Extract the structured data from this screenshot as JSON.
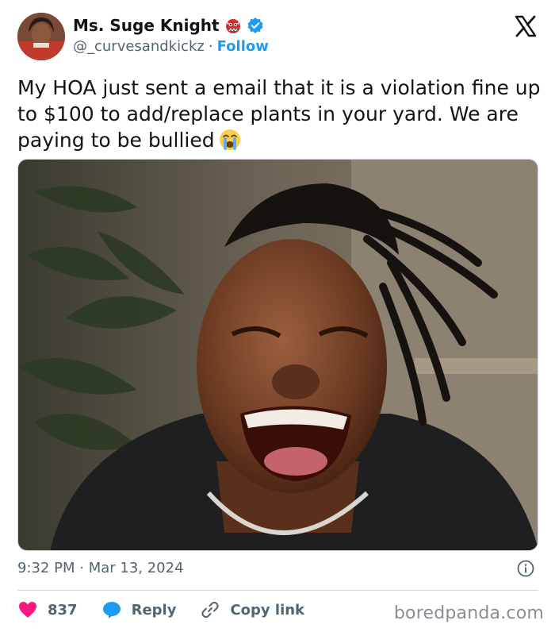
{
  "author": {
    "display_name": "Ms. Suge Knight",
    "handle": "@_curvesandkickz",
    "separator": "·",
    "follow_label": "Follow",
    "emoji_icon": "ogre-mask-icon",
    "verified_icon": "verified-badge-icon"
  },
  "tweet": {
    "text": "My HOA just sent a email that it is a violation fine up to $100 to add/replace plants in your yard. We are paying to be bullied",
    "emoji": "loudly-crying-face-icon"
  },
  "meta": {
    "timestamp": "9:32 PM · Mar 13, 2024"
  },
  "actions": {
    "like_count": "837",
    "reply_label": "Reply",
    "copy_link_label": "Copy link"
  },
  "watermark": "boredpanda.com",
  "colors": {
    "accent": "#1d9bf0",
    "like": "#f91880",
    "secondary_text": "#536471",
    "text": "#0f1419"
  }
}
